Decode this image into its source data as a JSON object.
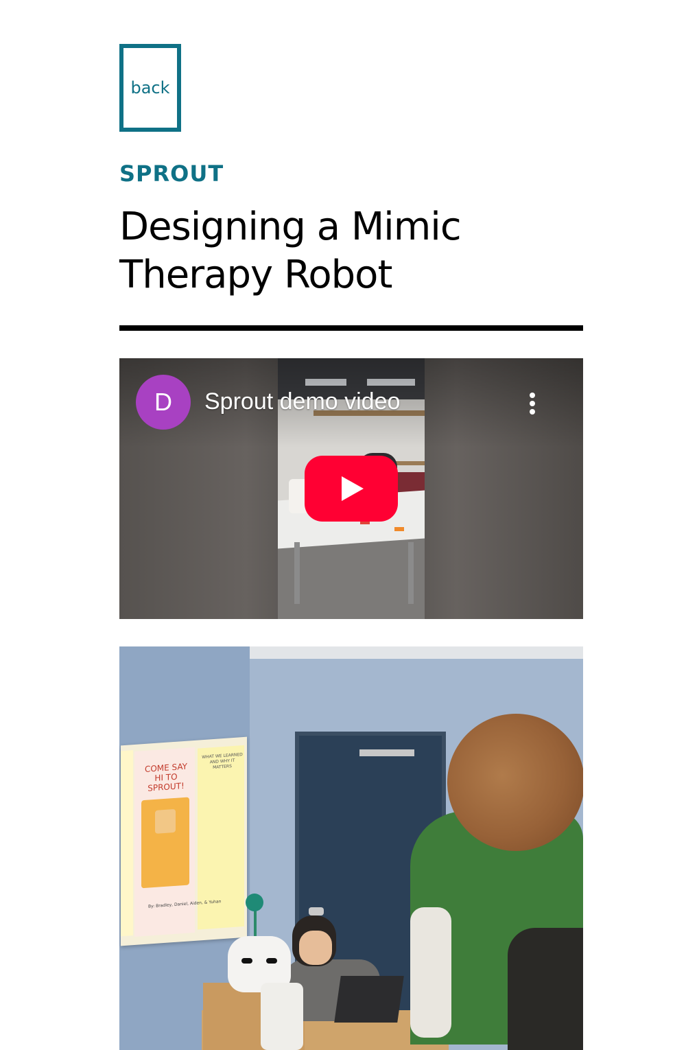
{
  "nav": {
    "back_label": "back"
  },
  "header": {
    "eyebrow": "SPROUT",
    "title_line1": "Designing a Mimic",
    "title_line2": "Therapy Robot"
  },
  "video": {
    "channel_initial": "D",
    "channel_avatar_color": "#a841c2",
    "title": "Sprout demo video",
    "play_button_color": "#ff0033",
    "icons": [
      "more-options-icon",
      "play-icon"
    ]
  },
  "photo": {
    "poster_title": "COME SAY HI TO SPROUT!",
    "poster_side_heading": "WHAT WE LEARNED AND WHY IT MATTERS",
    "poster_credit": "By: Bradley, Daniel, Aiden, & Yuhan"
  },
  "colors": {
    "accent": "#0f7186",
    "text": "#000000",
    "background": "#ffffff"
  }
}
